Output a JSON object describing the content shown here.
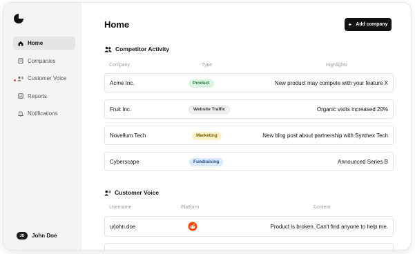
{
  "sidebar": {
    "items": [
      {
        "label": "Home",
        "icon": "home-icon",
        "active": true
      },
      {
        "label": "Companies",
        "icon": "companies-icon",
        "active": false
      },
      {
        "label": "Customer Voice",
        "icon": "customer-voice-icon",
        "active": false
      },
      {
        "label": "Reports",
        "icon": "reports-icon",
        "active": false
      },
      {
        "label": "Notifications",
        "icon": "bell-icon",
        "active": false
      }
    ],
    "user": {
      "initials": "JD",
      "name": "John Doe"
    }
  },
  "header": {
    "title": "Home",
    "add_button": "Add company"
  },
  "competitor_activity": {
    "title": "Competitor Activity",
    "columns": [
      "Company",
      "Type",
      "Highlights"
    ],
    "rows": [
      {
        "company": "Acme Inc.",
        "type": "Product",
        "highlight": "New product may compete with your feature X",
        "badge_bg": "#dcf5e3",
        "badge_fg": "#1f7a3a"
      },
      {
        "company": "Fruit Inc.",
        "type": "Website Traffic",
        "highlight": "Organic visits increased 20%",
        "badge_bg": "#f1f1f1",
        "badge_fg": "#333333"
      },
      {
        "company": "Novellum Tech",
        "type": "Marketing",
        "highlight": "New blog post about partnership with Synthex Tech",
        "badge_bg": "#fbf3c7",
        "badge_fg": "#7a5a00"
      },
      {
        "company": "Cyberscape",
        "type": "Fundraising",
        "highlight": "Announced Series B",
        "badge_bg": "#d8e9fb",
        "badge_fg": "#1e4f8a"
      }
    ]
  },
  "customer_voice": {
    "title": "Customer Voice",
    "columns": [
      "Username",
      "Platform",
      "Content"
    ],
    "rows": [
      {
        "username": "u/john.doe",
        "platform": "reddit-icon",
        "content": "Product is broken. Can't find anyone to help me."
      }
    ]
  },
  "colors": {
    "accent": "#111111",
    "sidebar_bg": "#f4f4f5",
    "alert_dot": "#e5484d",
    "reddit": "#ff4500"
  }
}
